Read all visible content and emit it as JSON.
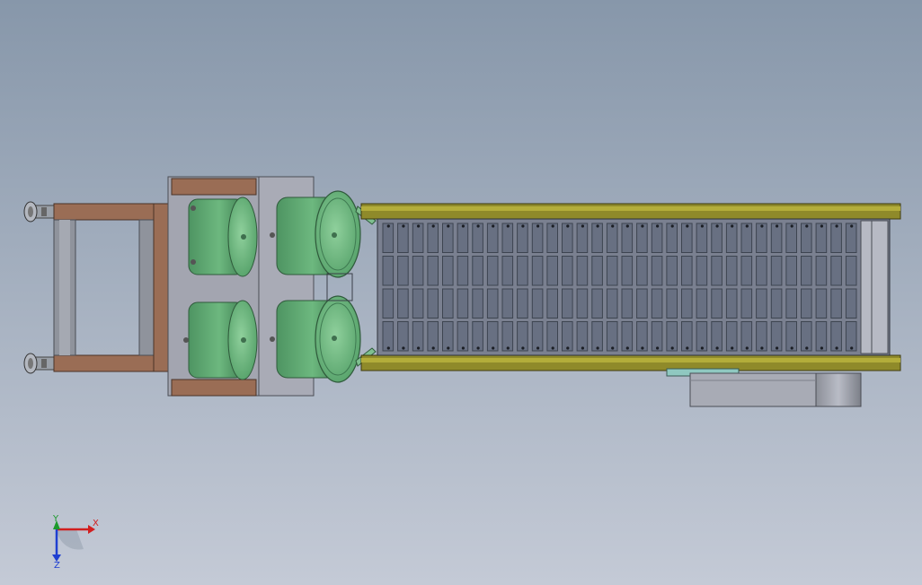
{
  "viewport": {
    "background_top": "#8797aa",
    "background_bottom": "#c4cad6"
  },
  "colors": {
    "frame_brown": "#9a6d55",
    "frame_gray": "#8f939c",
    "plate_gray": "#a3a5b0",
    "feeder_green": "#5fa873",
    "feeder_green_light": "#86c594",
    "conveyor_rail": "#8f8a2a",
    "conveyor_rail_light": "#b3ad3a",
    "slat_dark": "#3d4450",
    "slat_mid": "#687082",
    "axis_x": "#d11f1f",
    "axis_y": "#1c9a2c",
    "axis_z": "#1f3fd1"
  },
  "model": {
    "components": [
      "leveling-foot",
      "base-frame",
      "mount-plate",
      "vibratory-feeder-bowl",
      "slat-conveyor",
      "drive-motor-housing"
    ],
    "slat_count": 32
  },
  "triad": {
    "x_label": "X",
    "y_label": "Y",
    "z_label": "Z"
  }
}
